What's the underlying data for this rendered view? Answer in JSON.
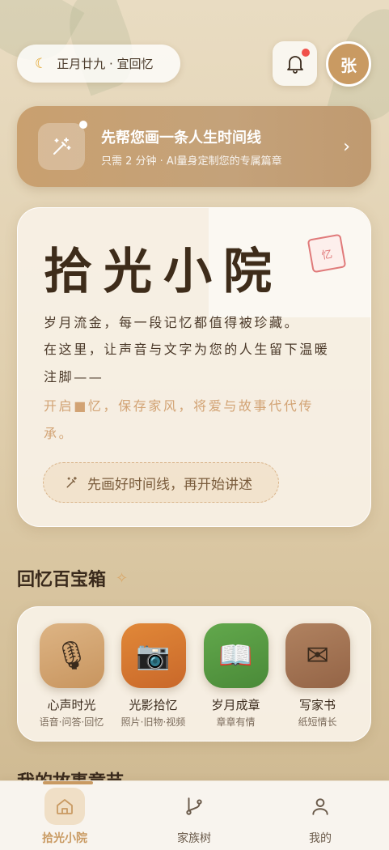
{
  "header": {
    "date_text": "正月廿九 · 宜回忆",
    "avatar_text": "张"
  },
  "banner": {
    "title": "先帮您画一条人生时间线",
    "subtitle": "只需 2 分钟 · AI量身定制您的专属篇章"
  },
  "hero": {
    "title": "拾光小院",
    "seal": "忆",
    "line1": "岁月流金，每一段记忆都值得被珍藏。",
    "line2": "在这里，让声音与文字为您的人生留下温暖",
    "line3": "注脚——",
    "accent1": "开启■忆，保存家风，将爱与故事代代传",
    "accent2": "承。",
    "button_label": "先画好时间线，再开始讲述"
  },
  "toolbox": {
    "title": "回忆百宝箱",
    "items": [
      {
        "name": "心声时光",
        "desc": "语音·问答·回忆",
        "icon": "microphone-icon",
        "color": "#d4a574"
      },
      {
        "name": "光影拾忆",
        "desc": "照片·旧物·视频",
        "icon": "camera-icon",
        "color": "#d6762e"
      },
      {
        "name": "岁月成章",
        "desc": "章章有情",
        "icon": "book-icon",
        "color": "#5a9a44"
      },
      {
        "name": "写家书",
        "desc": "纸短情长",
        "icon": "envelope-icon",
        "color": "#a57450"
      }
    ]
  },
  "stories": {
    "title": "我的故事章节"
  },
  "tabbar": {
    "items": [
      {
        "label": "拾光小院",
        "icon": "home-icon",
        "active": true
      },
      {
        "label": "家族树",
        "icon": "branch-icon",
        "active": false
      },
      {
        "label": "我的",
        "icon": "user-icon",
        "active": false
      }
    ]
  },
  "colors": {
    "accent": "#c99a62",
    "notification_dot": "#f0504a"
  }
}
